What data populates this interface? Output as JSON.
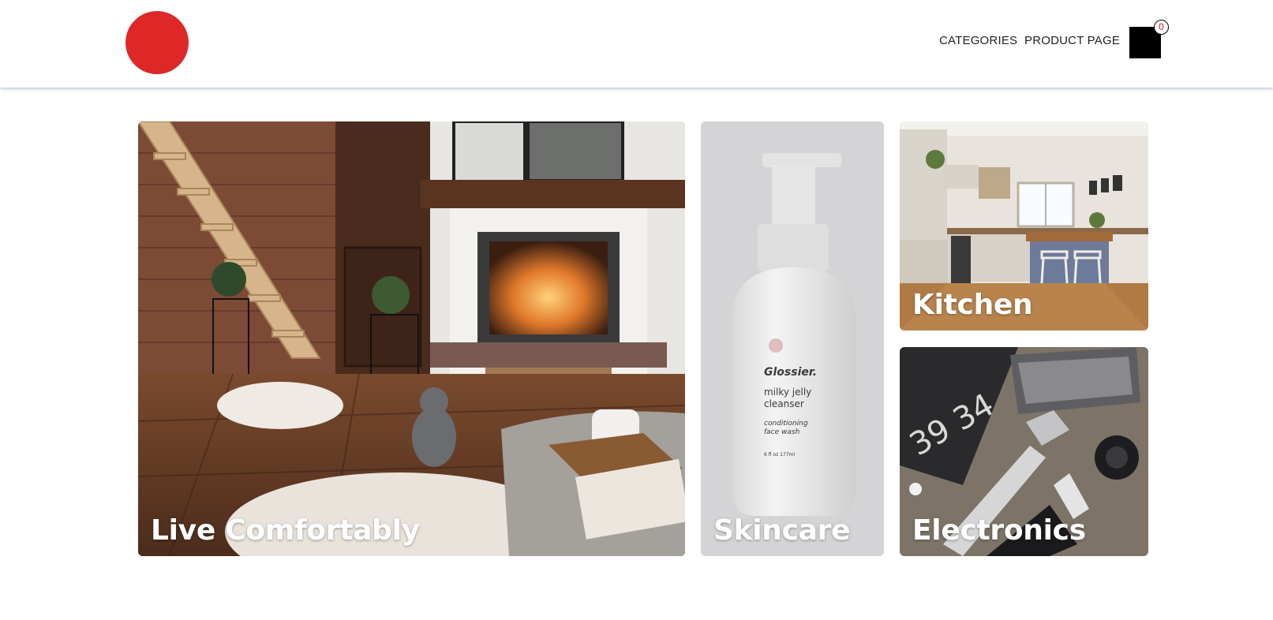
{
  "header": {
    "nav": {
      "categories": "CATEGORIES",
      "product_page": "PRODUCT PAGE"
    },
    "cart_count": "0"
  },
  "tiles": [
    {
      "label": "Live Comfortably"
    },
    {
      "label": "Skincare"
    },
    {
      "label": "Kitchen"
    },
    {
      "label": "Electronics"
    }
  ],
  "skincare_product": {
    "brand": "Glossier.",
    "name_line1": "milky jelly",
    "name_line2": "cleanser",
    "desc_line1": "conditioning",
    "desc_line2": "face wash",
    "size": "6 fl oz  177ml"
  },
  "electronics_clock": "39 34",
  "colors": {
    "logo": "#de2828",
    "cart": "#000000",
    "badge_text": "#d21f1f"
  }
}
